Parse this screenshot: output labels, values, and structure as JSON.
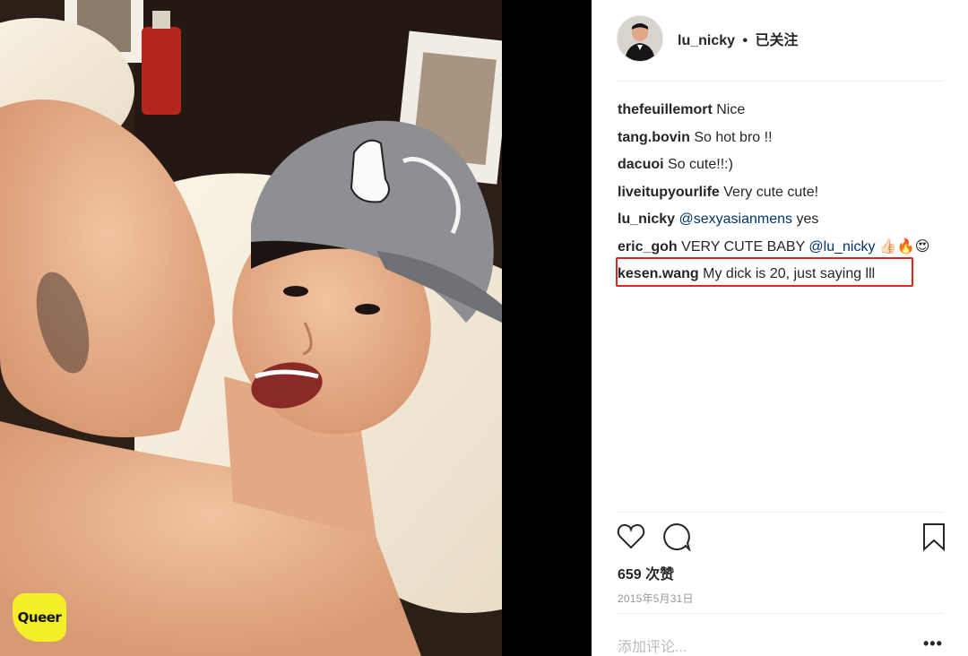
{
  "post": {
    "username": "lu_nicky",
    "separator": "•",
    "follow_status": "已关注",
    "comments": [
      {
        "user": "thefeuillemort",
        "parts": [
          {
            "text": "Nice"
          }
        ]
      },
      {
        "user": "tang.bovin",
        "parts": [
          {
            "text": "So hot bro !!"
          }
        ]
      },
      {
        "user": "dacuoi",
        "parts": [
          {
            "text": "So cute!!:)"
          }
        ]
      },
      {
        "user": "liveitupyourlife",
        "parts": [
          {
            "text": "Very cute cute!"
          }
        ]
      },
      {
        "user": "lu_nicky",
        "parts": [
          {
            "text": "@sexyasianmens",
            "mention": true
          },
          {
            "text": " yes"
          }
        ]
      },
      {
        "user": "eric_goh",
        "parts": [
          {
            "text": "VERY CUTE BABY "
          },
          {
            "text": "@lu_nicky",
            "mention": true
          },
          {
            "text": " 👍🏻🔥😍"
          }
        ]
      },
      {
        "user": "kesen.wang",
        "parts": [
          {
            "text": "My dick is 20, just saying lll"
          }
        ]
      }
    ],
    "likes_label": "659 次赞",
    "date": "2015年5月31日",
    "add_comment_placeholder": "添加评论...",
    "more_label": "•••"
  },
  "watermark": {
    "text": "Queer"
  },
  "colors": {
    "mention": "#003569",
    "highlight": "#e02424",
    "logo": "#f5ef2a"
  },
  "icons": [
    "heart-icon",
    "comment-icon",
    "bookmark-icon"
  ]
}
